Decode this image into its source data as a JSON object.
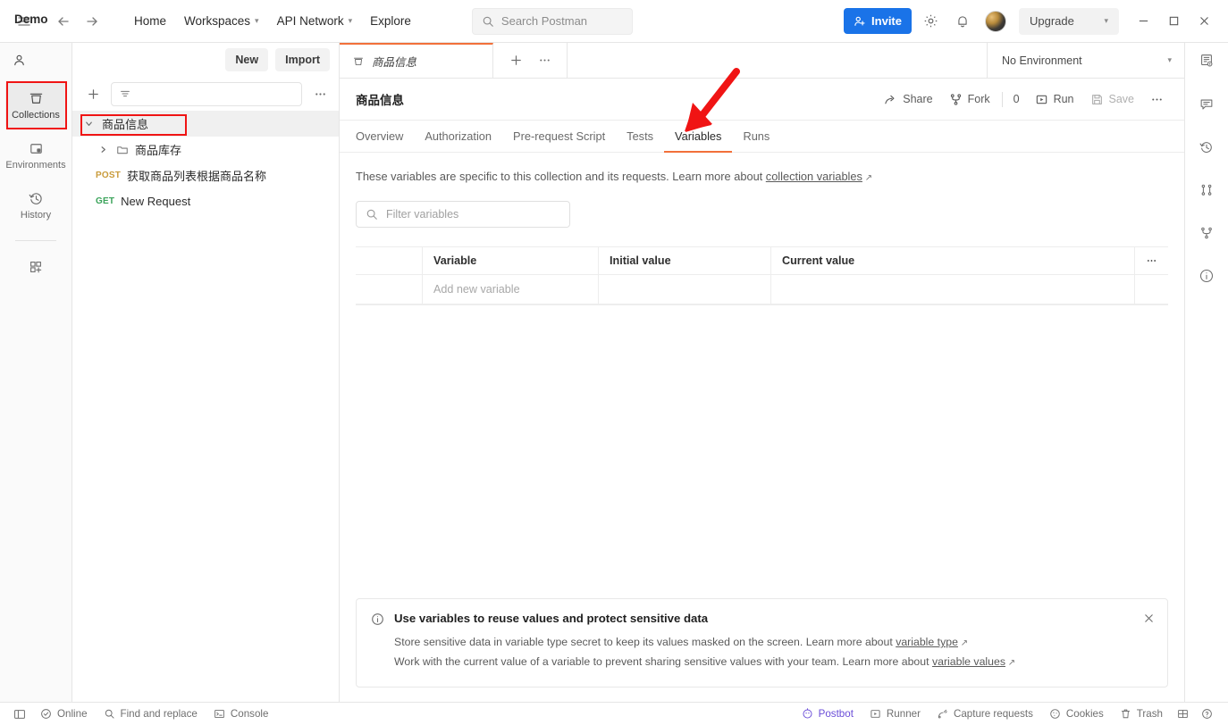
{
  "header": {
    "hamburger_icon": "menu-icon",
    "back_icon": "arrow-left-icon",
    "forward_icon": "arrow-right-icon",
    "nav": [
      {
        "label": "Home",
        "has_caret": false
      },
      {
        "label": "Workspaces",
        "has_caret": true
      },
      {
        "label": "API Network",
        "has_caret": true
      },
      {
        "label": "Explore",
        "has_caret": false
      }
    ],
    "search": {
      "placeholder": "Search Postman",
      "icon": "search-icon"
    },
    "invite_label": "Invite",
    "invite_color": "#1a73e8",
    "settings_icon": "gear-icon",
    "notifications_icon": "bell-icon",
    "avatar": "user-avatar",
    "upgrade_label": "Upgrade",
    "window": {
      "minimize": "minimize-icon",
      "maximize": "maximize-icon",
      "close": "close-icon"
    }
  },
  "workspace": {
    "name": "Demo",
    "new_label": "New",
    "import_label": "Import"
  },
  "rail": {
    "items": [
      {
        "label": "Collections",
        "icon": "collections-icon",
        "active": true
      },
      {
        "label": "Environments",
        "icon": "environments-icon",
        "active": false
      },
      {
        "label": "History",
        "icon": "history-icon",
        "active": false
      }
    ],
    "add_icon": "add-apps-icon"
  },
  "sidebar": {
    "add_icon": "plus-icon",
    "filter_placeholder": "",
    "filter_icon": "filter-icon",
    "more_icon": "ellipsis-icon",
    "tree": [
      {
        "label": "商品信息",
        "type": "collection",
        "depth": 0,
        "expanded": true,
        "selected": true
      },
      {
        "label": "商品库存",
        "type": "folder",
        "depth": 1,
        "expanded": false
      },
      {
        "label": "获取商品列表根据商品名称",
        "type": "request",
        "method": "POST",
        "depth": 1
      },
      {
        "label": "New Request",
        "type": "request",
        "method": "GET",
        "depth": 1
      }
    ]
  },
  "tabbar": {
    "tabs": [
      {
        "label": "商品信息",
        "icon": "collection-icon",
        "active": true
      }
    ],
    "new_tab_icon": "plus-icon",
    "tab_more_icon": "ellipsis-icon",
    "environment_selector": "No Environment"
  },
  "content": {
    "title": "商品信息",
    "actions": {
      "share": "Share",
      "fork": "Fork",
      "fork_count": "0",
      "run": "Run",
      "save": "Save",
      "more_icon": "ellipsis-icon"
    },
    "subtabs": [
      {
        "label": "Overview",
        "active": false
      },
      {
        "label": "Authorization",
        "active": false
      },
      {
        "label": "Pre-request Script",
        "active": false
      },
      {
        "label": "Tests",
        "active": false
      },
      {
        "label": "Variables",
        "active": true
      },
      {
        "label": "Runs",
        "active": false
      }
    ],
    "description": {
      "text": "These variables are specific to this collection and its requests. Learn more about ",
      "link": "collection variables"
    },
    "filter_placeholder": "Filter variables",
    "table": {
      "columns": [
        "",
        "Variable",
        "Initial value",
        "Current value"
      ],
      "rows": [
        {
          "checkbox": "",
          "variable": "Add new variable",
          "initial_value": "",
          "current_value": ""
        }
      ],
      "menu_icon": "ellipsis-icon"
    },
    "banner": {
      "icon": "info-icon",
      "title": "Use variables to reuse values and protect sensitive data",
      "line1_text": "Store sensitive data in variable type secret to keep its values masked on the screen. Learn more about ",
      "line1_link": "variable type",
      "line2_text": "Work with the current value of a variable to prevent sharing sensitive values with your team. Learn more about ",
      "line2_link": "variable values",
      "close_icon": "close-icon"
    }
  },
  "right_rail": {
    "items": [
      {
        "icon": "documentation-icon"
      },
      {
        "icon": "comments-icon"
      },
      {
        "icon": "activity-history-icon"
      },
      {
        "icon": "pull-requests-icon"
      },
      {
        "icon": "forks-icon"
      },
      {
        "icon": "info-circle-icon"
      }
    ]
  },
  "statusbar": {
    "left": [
      {
        "label": "",
        "icon": "sidebar-toggle-icon"
      },
      {
        "label": "Online",
        "icon": "online-check-icon"
      },
      {
        "label": "Find and replace",
        "icon": "search-icon"
      },
      {
        "label": "Console",
        "icon": "console-icon"
      }
    ],
    "right": [
      {
        "label": "Postbot",
        "icon": "postbot-icon",
        "color": "#6b4ed8"
      },
      {
        "label": "Runner",
        "icon": "runner-icon"
      },
      {
        "label": "Capture requests",
        "icon": "capture-icon"
      },
      {
        "label": "Cookies",
        "icon": "cookies-icon"
      },
      {
        "label": "Trash",
        "icon": "trash-icon"
      },
      {
        "label": "",
        "icon": "layout-icon"
      },
      {
        "label": "",
        "icon": "help-icon"
      }
    ]
  },
  "annotations": {
    "color": "#f01414",
    "box_collections": "red-box-around-collections-rail-item",
    "box_collection_row": "red-box-around-collection-row",
    "arrow_variables": "red-arrow-pointing-to-variables-tab"
  }
}
